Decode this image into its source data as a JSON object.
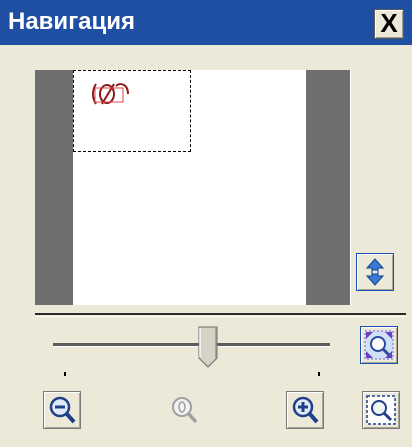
{
  "window": {
    "title": "Навигация",
    "close_label": "X"
  },
  "thumbnail": {
    "background": "#ffffff",
    "side_bar_color": "#6f6f6f"
  },
  "zoom_slider": {
    "level": 0.56
  },
  "buttons": {
    "fit_page": "fit-page-arrows-icon",
    "fit_width": "fit-width-icon",
    "zoom_out": "zoom-out-icon",
    "actual_size": "actual-size-icon",
    "zoom_in": "zoom-in-icon",
    "zoom_selection": "zoom-selection-icon"
  },
  "colors": {
    "titlebar": "#1f4fa2",
    "panel": "#ece9d8",
    "accent": "#1a4fb3"
  }
}
